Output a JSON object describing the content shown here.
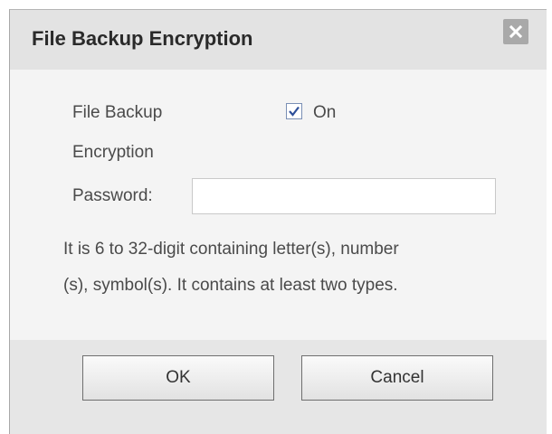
{
  "dialog": {
    "title": "File Backup Encryption",
    "close_icon": "close-icon",
    "encryption_label_line1": "File Backup",
    "encryption_label_line2": "Encryption",
    "encryption_checked": true,
    "encryption_option_label": "On",
    "password_label": "Password:",
    "password_value": "",
    "hint_line1": "It is 6 to 32-digit containing letter(s), number",
    "hint_line2": "(s), symbol(s). It contains at least two types.",
    "ok_label": "OK",
    "cancel_label": "Cancel"
  }
}
